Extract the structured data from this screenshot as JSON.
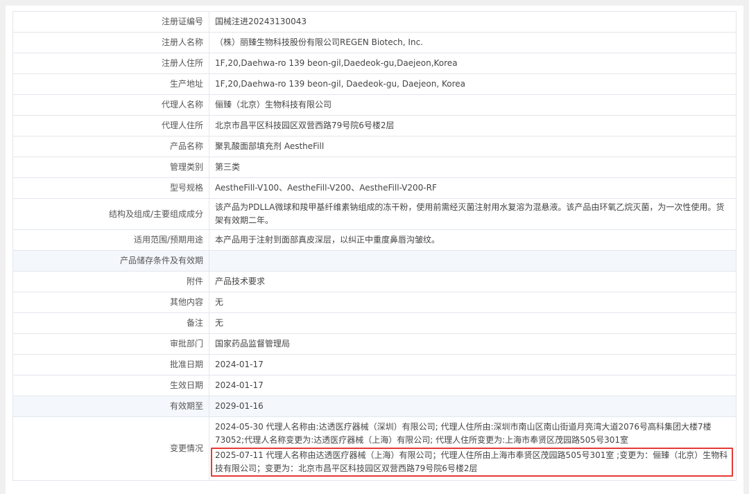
{
  "rows": [
    {
      "label": "注册证编号",
      "value": "国械注进20243130043"
    },
    {
      "label": "注册人名称",
      "value": "（株）丽臻生物科技股份有限公司REGEN Biotech, Inc."
    },
    {
      "label": "注册人住所",
      "value": "1F,20,Daehwa-ro 139 beon-gil,Daedeok-gu,Daejeon,Korea"
    },
    {
      "label": "生产地址",
      "value": "1F,20,Daehwa-ro 139 beon-gil, Daedeok-gu, Daejeon, Korea"
    },
    {
      "label": "代理人名称",
      "value": "俪臻（北京）生物科技有限公司"
    },
    {
      "label": "代理人住所",
      "value": "北京市昌平区科技园区双营西路79号院6号楼2层"
    },
    {
      "label": "产品名称",
      "value": "聚乳酸面部填充剂 AestheFill"
    },
    {
      "label": "管理类别",
      "value": "第三类"
    },
    {
      "label": "型号规格",
      "value": "AestheFill-V100、AestheFill-V200、AestheFill-V200-RF"
    },
    {
      "label": "结构及组成/主要组成成分",
      "value": "该产品为PDLLA微球和羧甲基纤维素钠组成的冻干粉，使用前需经灭菌注射用水复溶为混悬液。该产品由环氧乙烷灭菌，为一次性使用。货架有效期二年。"
    },
    {
      "label": "适用范围/预期用途",
      "value": "本产品用于注射到面部真皮深层，以纠正中重度鼻唇沟皱纹。"
    },
    {
      "label": "产品储存条件及有效期",
      "value": ""
    },
    {
      "label": "附件",
      "value": "产品技术要求"
    },
    {
      "label": "其他内容",
      "value": "无"
    },
    {
      "label": "备注",
      "value": "无"
    },
    {
      "label": "审批部门",
      "value": "国家药品监督管理局"
    },
    {
      "label": "批准日期",
      "value": "2024-01-17"
    },
    {
      "label": "生效日期",
      "value": "2024-01-17"
    },
    {
      "label": "有效期至",
      "value": "2029-01-16"
    }
  ],
  "changes": {
    "label": "变更情况",
    "entries": [
      "2024-05-30 代理人名称由:达透医疗器械（深圳）有限公司; 代理人住所由:深圳市南山区南山街道月亮湾大道2076号高科集团大楼7楼73052;代理人名称变更为:达透医疗器械（上海）有限公司; 代理人住所变更为:上海市奉贤区茂园路505号301室",
      "2025-07-11 代理人名称由达透医疗器械（上海）有限公司；代理人住所由上海市奉贤区茂园路505号301室 ;变更为：俪臻（北京）生物科技有限公司；变更为：北京市昌平区科技园区双营西路79号院6号楼2层"
    ]
  },
  "colors": {
    "border": "#e2e6ec",
    "alt_row_bg": "#f4f7fb",
    "highlight": "#e53935"
  }
}
